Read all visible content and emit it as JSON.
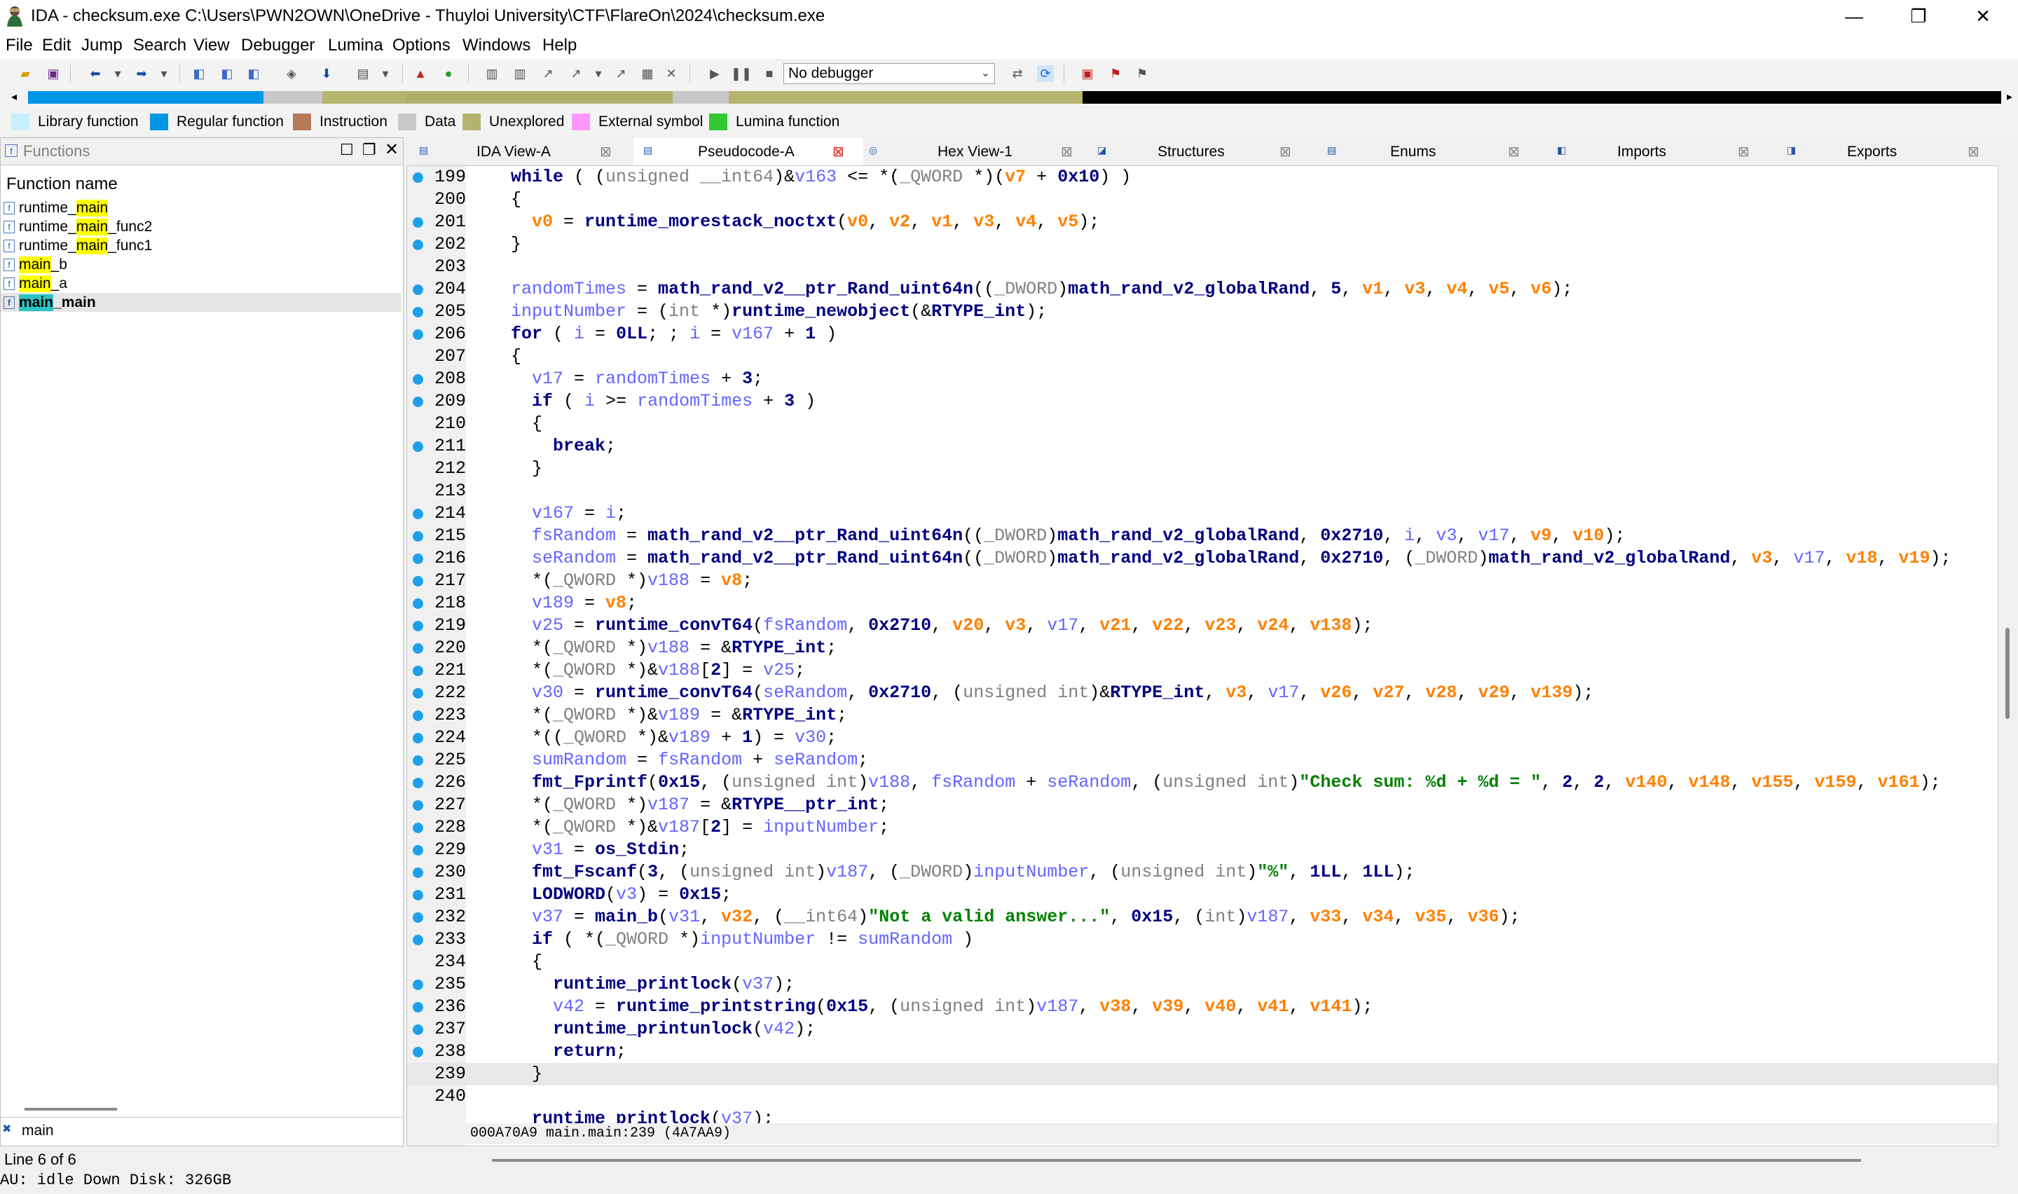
{
  "window": {
    "title": "IDA - checksum.exe C:\\Users\\PWN2OWN\\OneDrive - Thuyloi University\\CTF\\FlareOn\\2024\\checksum.exe",
    "minimize": "—",
    "restore": "❐",
    "close": "✕"
  },
  "menu": [
    "File",
    "Edit",
    "Jump",
    "Search",
    "View",
    "Debugger",
    "Lumina",
    "Options",
    "Windows",
    "Help"
  ],
  "toolbar": {
    "debugger_select": "No debugger"
  },
  "legend": [
    {
      "label": "Library function",
      "color": "#c8f0ff"
    },
    {
      "label": "Regular function",
      "color": "#0096e6"
    },
    {
      "label": "Instruction",
      "color": "#b47a5a"
    },
    {
      "label": "Data",
      "color": "#c8c8c8"
    },
    {
      "label": "Unexplored",
      "color": "#b4b46e"
    },
    {
      "label": "External symbol",
      "color": "#ff96ff"
    },
    {
      "label": "Lumina function",
      "color": "#32c832"
    }
  ],
  "functions": {
    "title": "Functions",
    "column": "Function name",
    "items": [
      {
        "pre": "runtime_",
        "hl": "main",
        "post": ""
      },
      {
        "pre": "runtime_",
        "hl": "main",
        "post": "_func2"
      },
      {
        "pre": "runtime_",
        "hl": "main",
        "post": "_func1"
      },
      {
        "pre": "",
        "hl": "main",
        "post": "_b"
      },
      {
        "pre": "",
        "hl": "main",
        "post": "_a"
      },
      {
        "pre": "",
        "hl": "main",
        "post": "_main"
      }
    ],
    "search": "main"
  },
  "tabs": [
    {
      "label": "IDA View-A"
    },
    {
      "label": "Pseudocode-A"
    },
    {
      "label": "Hex View-1"
    },
    {
      "label": "Structures"
    },
    {
      "label": "Enums"
    },
    {
      "label": "Imports"
    },
    {
      "label": "Exports"
    }
  ],
  "code": {
    "current_line": "239",
    "status": "000A70A9 main.main:239 (4A7AA9)"
  },
  "status": {
    "line": "Line 6 of 6",
    "state": "AU:  idle   Down  Disk: 326GB"
  }
}
